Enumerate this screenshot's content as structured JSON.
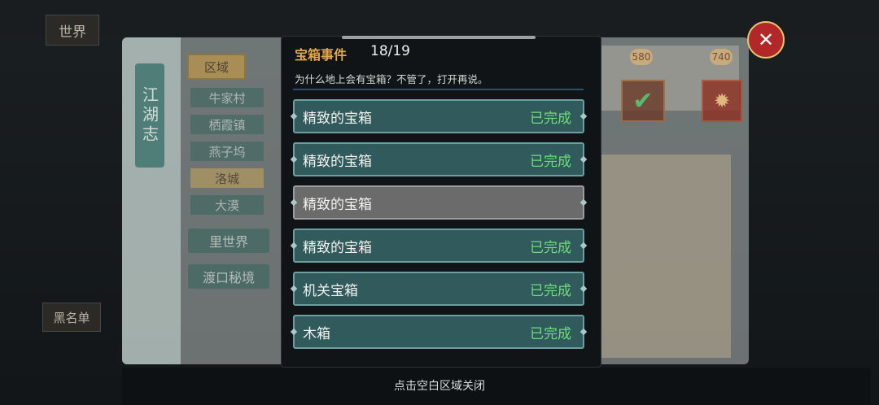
{
  "background": {
    "world_button": "世界",
    "blacklist_button": "黑名单",
    "journal_title": "江湖志",
    "region_header": "区域",
    "regions": [
      "牛家村",
      "栖霞镇",
      "燕子坞",
      "洛城",
      "大漠"
    ],
    "side_buttons": [
      "里世界",
      "渡口秘境"
    ],
    "badges": [
      "580",
      "740"
    ],
    "check_icon": "✔",
    "gem_icon": "✹"
  },
  "modal": {
    "title": "宝箱事件",
    "count": "18/19",
    "subtitle": "为什么地上会有宝箱？不管了，打开再说。",
    "items": [
      {
        "name": "精致的宝箱",
        "status": "已完成"
      },
      {
        "name": "精致的宝箱",
        "status": "已完成"
      },
      {
        "name": "精致的宝箱",
        "status": ""
      },
      {
        "name": "精致的宝箱",
        "status": "已完成"
      },
      {
        "name": "机关宝箱",
        "status": "已完成"
      },
      {
        "name": "木箱",
        "status": "已完成"
      }
    ]
  },
  "footer": {
    "hint": "点击空白区域关闭"
  },
  "colors": {
    "accent": "#e2a64a",
    "complete": "#6fdc7b",
    "item_bg": "#305a5c",
    "close": "#b22828"
  }
}
